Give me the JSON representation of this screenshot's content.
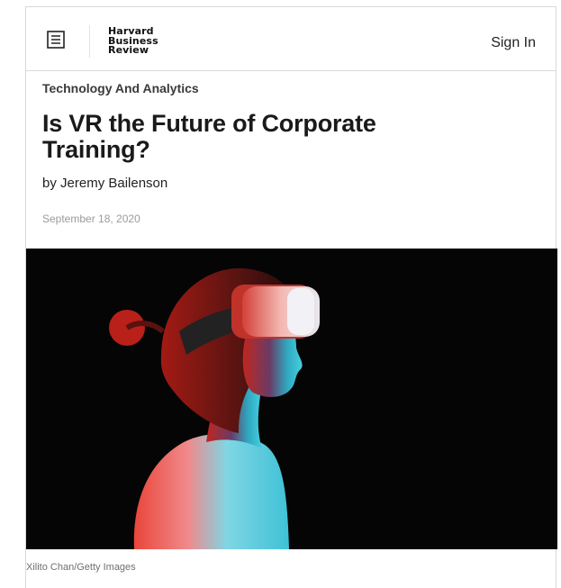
{
  "header": {
    "menu_icon": "menu-icon",
    "logo_lines": [
      "Harvard",
      "Business",
      "Review"
    ],
    "sign_in_label": "Sign In"
  },
  "article": {
    "topic": "Technology And Analytics",
    "title": "Is VR the Future of Corporate Training?",
    "byline_prefix": "by ",
    "author": "Jeremy Bailenson",
    "date": "September 18, 2020"
  },
  "image": {
    "subject": "woman-wearing-vr-headset",
    "credit": "Xilito Chan/Getty Images",
    "colors": {
      "background": "#050505",
      "red_light": "#e0302a",
      "cyan_light": "#39c6dc"
    }
  }
}
